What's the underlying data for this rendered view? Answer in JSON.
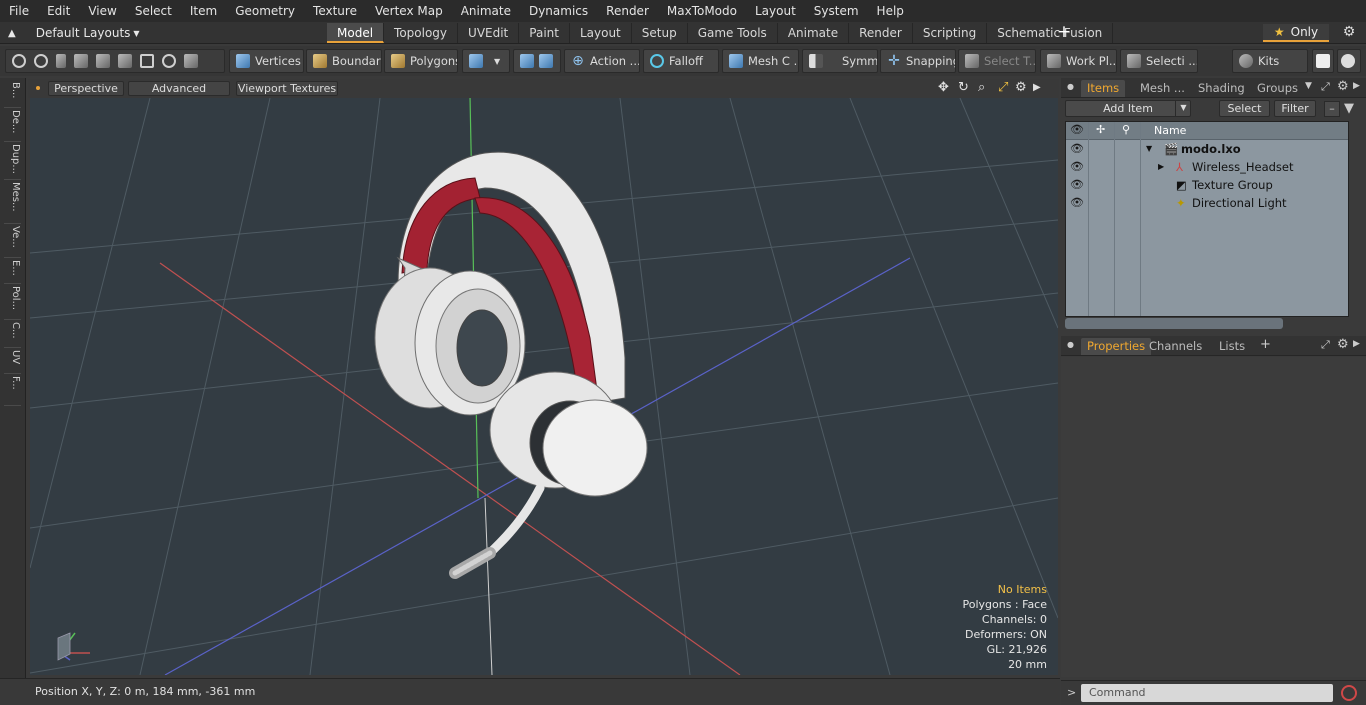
{
  "menu": [
    "File",
    "Edit",
    "View",
    "Select",
    "Item",
    "Geometry",
    "Texture",
    "Vertex Map",
    "Animate",
    "Dynamics",
    "Render",
    "MaxToModo",
    "Layout",
    "System",
    "Help"
  ],
  "layout": {
    "dropdown": "Default Layouts"
  },
  "tabs": [
    "Model",
    "Topology",
    "UVEdit",
    "Paint",
    "Layout",
    "Setup",
    "Game Tools",
    "Animate",
    "Render",
    "Scripting",
    "Schematic Fusion"
  ],
  "only_label": "Only",
  "toolbar": {
    "vertices": "Vertices",
    "boundary": "Boundary",
    "polygons": "Polygons",
    "action": "Action ...",
    "falloff": "Falloff",
    "mesh": "Mesh C ...",
    "symm": "Symm ...",
    "snapping": "Snapping",
    "select_t": "Select T...",
    "workpl": "Work Pl...",
    "selecti": "Selecti ...",
    "kits": "Kits"
  },
  "left_tabs": [
    "B...",
    "De...",
    "Dup...",
    "Mes...",
    "Ve...",
    "E...",
    "Pol...",
    "C...",
    "UV",
    "F..."
  ],
  "viewport": {
    "perspective": "Perspective",
    "advanced": "Advanced",
    "viewport_textures": "Viewport Textures",
    "info": {
      "no_items": "No Items",
      "polygons": "Polygons : Face",
      "channels": "Channels: 0",
      "deformers": "Deformers: ON",
      "gl": "GL: 21,926",
      "scale": "20 mm"
    }
  },
  "status": {
    "position": "Position X, Y, Z:   0 m, 184 mm, -361 mm"
  },
  "items_panel": {
    "tabs": [
      "Items",
      "Mesh ...",
      "Shading",
      "Groups"
    ],
    "add_item": "Add Item",
    "select": "Select",
    "filter": "Filter",
    "col_name": "Name",
    "rows": [
      "modo.lxo",
      "Wireless_Headset",
      "Texture Group",
      "Directional Light"
    ]
  },
  "props_panel": {
    "tabs": [
      "Properties",
      "Channels",
      "Lists"
    ]
  },
  "command": {
    "placeholder": "Command"
  }
}
